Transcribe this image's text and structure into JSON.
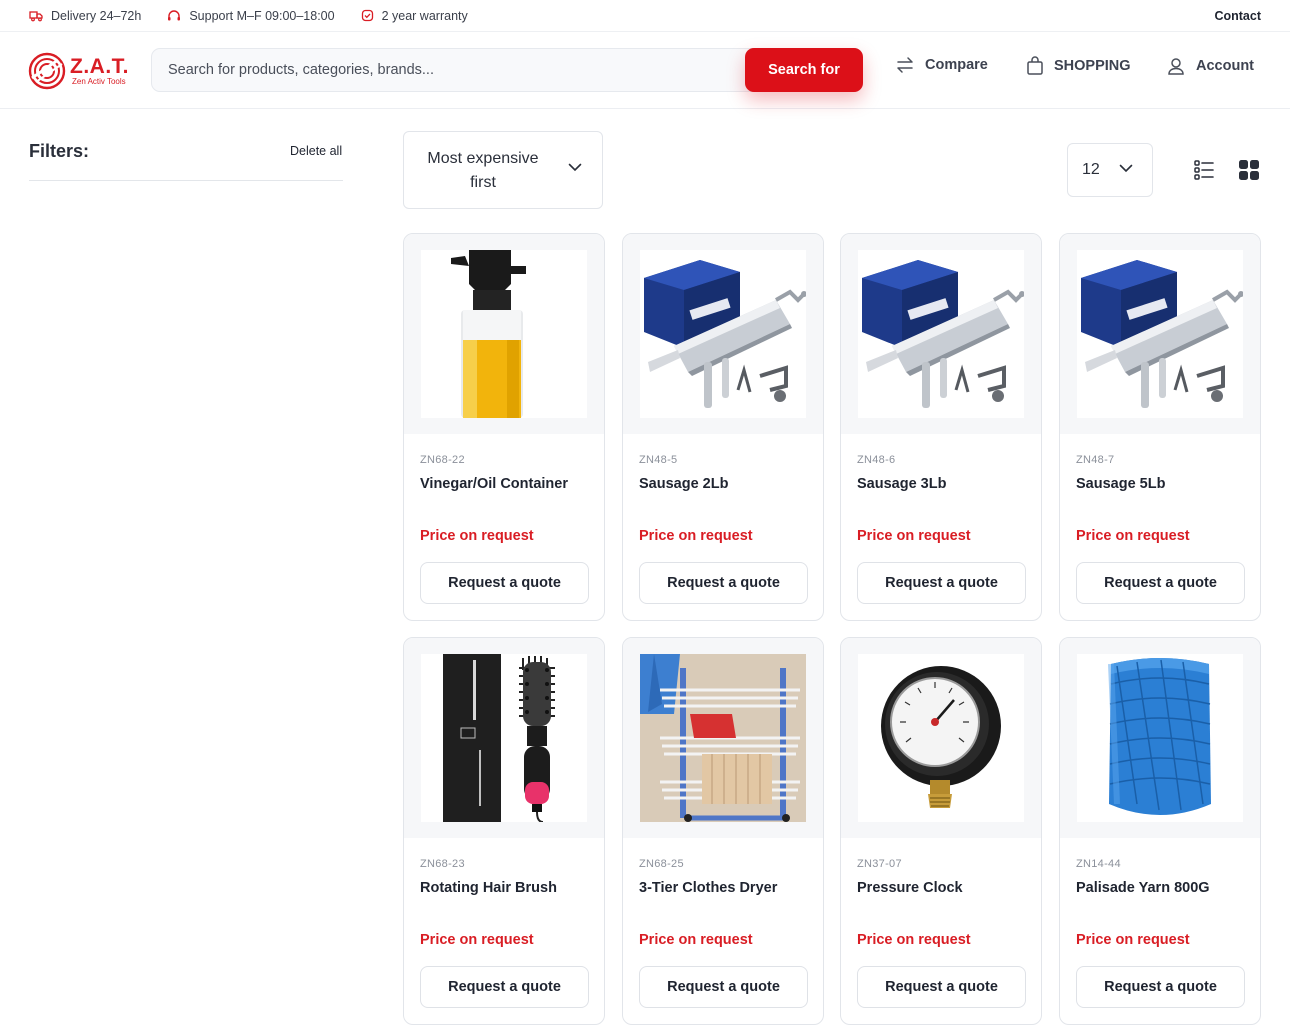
{
  "topbar": {
    "delivery": "Delivery 24–72h",
    "support": "Support M–F 09:00–18:00",
    "warranty": "2 year warranty",
    "contact": "Contact"
  },
  "brand": {
    "title": "Z.A.T.",
    "subtitle": "Zen Activ Tools",
    "color": "#d91d24"
  },
  "search": {
    "placeholder": "Search for products, categories, brands...",
    "value": "",
    "button": "Search for"
  },
  "header_nav": {
    "compare": "Compare",
    "shopping": "SHOPPING",
    "account": "Account"
  },
  "filters": {
    "title": "Filters:",
    "delete_all": "Delete all"
  },
  "toolbar": {
    "sort_selected": "Most expensive first",
    "per_page": "12",
    "view_icons": [
      "list-view-icon",
      "grid-view-icon"
    ],
    "active_view": "grid"
  },
  "products": [
    {
      "sku": "ZN68-22",
      "name": "Vinegar/Oil Container",
      "price": "Price on request",
      "action": "Request a quote",
      "image": "oil-sprayer-bottle"
    },
    {
      "sku": "ZN48-5",
      "name": "Sausage 2Lb",
      "price": "Price on request",
      "action": "Request a quote",
      "image": "sausage-stuffer"
    },
    {
      "sku": "ZN48-6",
      "name": "Sausage 3Lb",
      "price": "Price on request",
      "action": "Request a quote",
      "image": "sausage-stuffer"
    },
    {
      "sku": "ZN48-7",
      "name": "Sausage 5Lb",
      "price": "Price on request",
      "action": "Request a quote",
      "image": "sausage-stuffer"
    },
    {
      "sku": "ZN68-23",
      "name": "Rotating Hair Brush",
      "price": "Price on request",
      "action": "Request a quote",
      "image": "hair-brush"
    },
    {
      "sku": "ZN68-25",
      "name": "3-Tier Clothes Dryer",
      "price": "Price on request",
      "action": "Request a quote",
      "image": "clothes-dryer"
    },
    {
      "sku": "ZN37-07",
      "name": "Pressure Clock",
      "price": "Price on request",
      "action": "Request a quote",
      "image": "pressure-gauge"
    },
    {
      "sku": "ZN14-44",
      "name": "Palisade Yarn 800G",
      "price": "Price on request",
      "action": "Request a quote",
      "image": "yarn-spool"
    }
  ],
  "colors": {
    "accent": "#dc1018",
    "price": "#d91d24",
    "border": "#e2e5ea"
  }
}
